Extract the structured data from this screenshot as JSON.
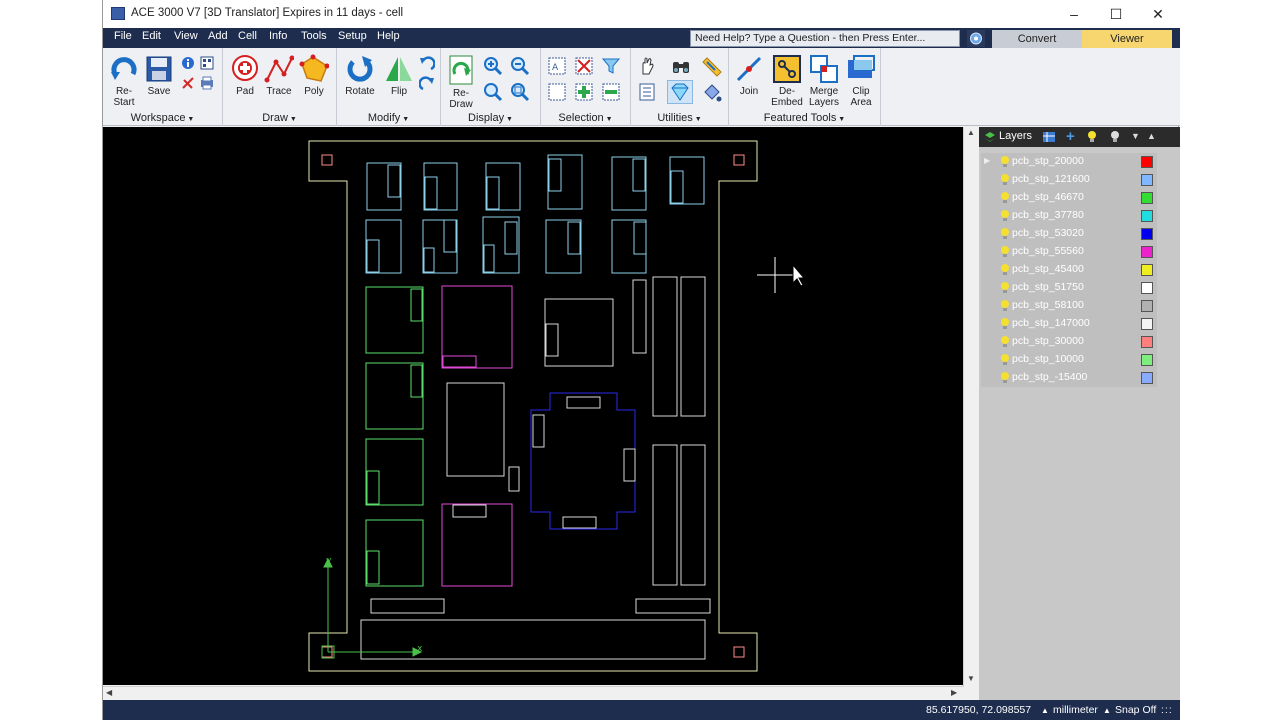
{
  "window": {
    "title": "ACE 3000 V7 [3D Translator]  Expires in 11 days  - cell",
    "minimize": "–",
    "maximize": "☐",
    "close": "✕"
  },
  "menu": [
    "File",
    "Edit",
    "View",
    "Add",
    "Cell",
    "Info",
    "Tools",
    "Setup",
    "Help"
  ],
  "help_placeholder": "Need Help?  Type a Question - then Press Enter...",
  "mode_tabs": {
    "convert": "Convert",
    "viewer": "Viewer"
  },
  "ribbon": {
    "workspace": {
      "label": "Workspace",
      "restart": "Re-\nStart",
      "save": "Save"
    },
    "draw": {
      "label": "Draw",
      "pad": "Pad",
      "trace": "Trace",
      "poly": "Poly"
    },
    "modify": {
      "label": "Modify",
      "rotate": "Rotate",
      "flip": "Flip"
    },
    "display": {
      "label": "Display",
      "redraw": "Re-\nDraw"
    },
    "selection": {
      "label": "Selection"
    },
    "utilities": {
      "label": "Utilities"
    },
    "featured": {
      "label": "Featured Tools",
      "join": "Join",
      "deembed": "De-\nEmbed",
      "merge": "Merge\nLayers",
      "clip": "Clip\nArea"
    }
  },
  "axes": {
    "x": "x",
    "y": "y"
  },
  "layers_panel": {
    "title": "Layers",
    "items": [
      {
        "name": "pcb_stp_20000",
        "color": "#ff0000"
      },
      {
        "name": "pcb_stp_121600",
        "color": "#7fb8ff"
      },
      {
        "name": "pcb_stp_46670",
        "color": "#33dd33"
      },
      {
        "name": "pcb_stp_37780",
        "color": "#22dddd"
      },
      {
        "name": "pcb_stp_53020",
        "color": "#0000ee"
      },
      {
        "name": "pcb_stp_55560",
        "color": "#ee22cc"
      },
      {
        "name": "pcb_stp_45400",
        "color": "#eeee22"
      },
      {
        "name": "pcb_stp_51750",
        "color": "#ffffff"
      },
      {
        "name": "pcb_stp_58100",
        "color": "#b0b0b0"
      },
      {
        "name": "pcb_stp_147000",
        "color": "#f4f4f4"
      },
      {
        "name": "pcb_stp_30000",
        "color": "#ff7f7f"
      },
      {
        "name": "pcb_stp_10000",
        "color": "#7fee7f"
      },
      {
        "name": "pcb_stp_-15400",
        "color": "#88aaff"
      }
    ]
  },
  "status": {
    "coords": "85.617950, 72.098557",
    "units": "millimeter",
    "snap": "Snap Off"
  }
}
